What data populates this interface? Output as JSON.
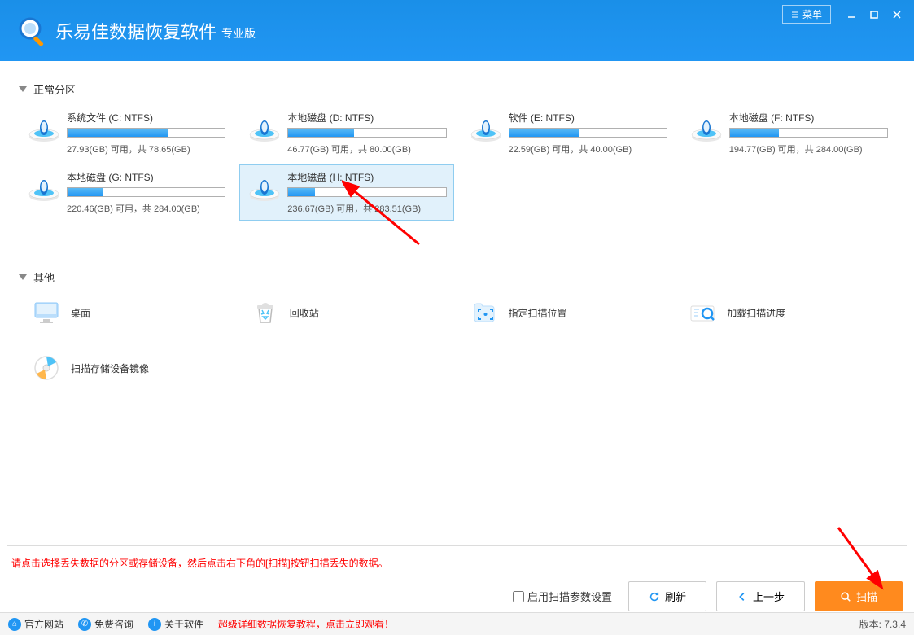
{
  "header": {
    "title": "乐易佳数据恢复软件",
    "subtitle": "专业版",
    "menu_label": "菜单"
  },
  "sections": {
    "normal_partitions": "正常分区",
    "other": "其他"
  },
  "partitions": [
    {
      "name": "系统文件 (C: NTFS)",
      "used_pct": 64,
      "free": "27.93(GB)",
      "total": "78.65(GB)",
      "selected": false
    },
    {
      "name": "本地磁盘 (D: NTFS)",
      "used_pct": 42,
      "free": "46.77(GB)",
      "total": "80.00(GB)",
      "selected": false
    },
    {
      "name": "软件 (E: NTFS)",
      "used_pct": 44,
      "free": "22.59(GB)",
      "total": "40.00(GB)",
      "selected": false
    },
    {
      "name": "本地磁盘 (F: NTFS)",
      "used_pct": 31,
      "free": "194.77(GB)",
      "total": "284.00(GB)",
      "selected": false
    },
    {
      "name": "本地磁盘 (G: NTFS)",
      "used_pct": 22,
      "free": "220.46(GB)",
      "total": "284.00(GB)",
      "selected": false
    },
    {
      "name": "本地磁盘 (H: NTFS)",
      "used_pct": 17,
      "free": "236.67(GB)",
      "total": "283.51(GB)",
      "selected": true
    }
  ],
  "stats_template": {
    "free_label": " 可用，共 "
  },
  "other_items": [
    {
      "label": "桌面",
      "icon": "desktop"
    },
    {
      "label": "回收站",
      "icon": "recycle"
    },
    {
      "label": "指定扫描位置",
      "icon": "target"
    },
    {
      "label": "加载扫描进度",
      "icon": "load"
    },
    {
      "label": "扫描存储设备镜像",
      "icon": "disc"
    }
  ],
  "hint": "请点击选择丢失数据的分区或存储设备，然后点击右下角的[扫描]按钮扫描丢失的数据。",
  "actions": {
    "enable_params": "启用扫描参数设置",
    "refresh": "刷新",
    "prev": "上一步",
    "scan": "扫描"
  },
  "footer": {
    "official_site": "官方网站",
    "free_consult": "免费咨询",
    "about": "关于软件",
    "tutorial": "超级详细数据恢复教程，点击立即观看！",
    "version_label": "版本: ",
    "version": "7.3.4"
  }
}
